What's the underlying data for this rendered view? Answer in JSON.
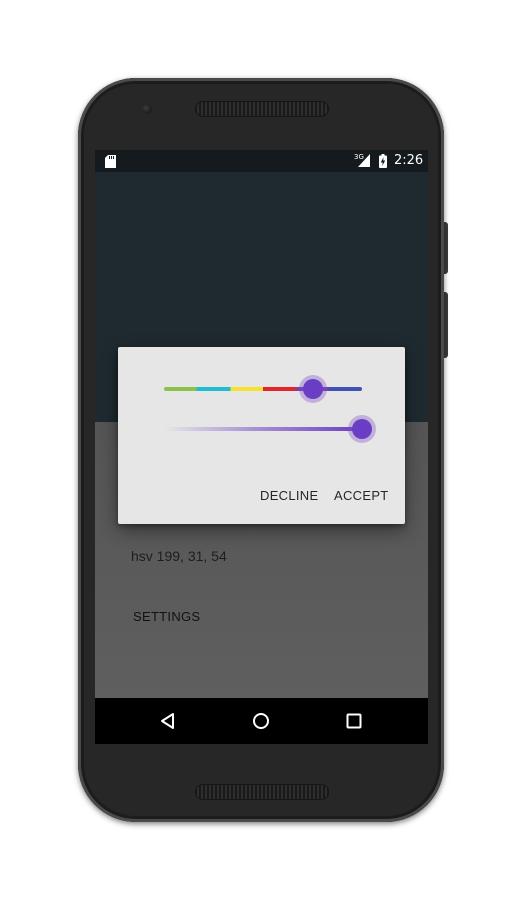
{
  "status_bar": {
    "time": "2:26",
    "network_type": "3G",
    "bar_color": "#141a1d"
  },
  "app": {
    "hsv_text": "hsv 199, 31, 54",
    "settings_label": "SETTINGS",
    "top_color": "#1f2a30",
    "bottom_color": "#5e5e5e"
  },
  "dialog": {
    "hue_slider": {
      "segments": [
        "#8bc34a",
        "#1fbcd2",
        "#f5e12e",
        "#e0262b",
        "#7b3fb0",
        "#3f51b5"
      ],
      "value_fraction": 0.75
    },
    "saturation_slider": {
      "value_fraction": 1.0
    },
    "thumb_color": "#6a3ec4",
    "decline_label": "DECLINE",
    "accept_label": "ACCEPT"
  },
  "nav_bar": {
    "back_icon": "triangle-back-icon",
    "home_icon": "circle-home-icon",
    "recents_icon": "square-recents-icon"
  }
}
